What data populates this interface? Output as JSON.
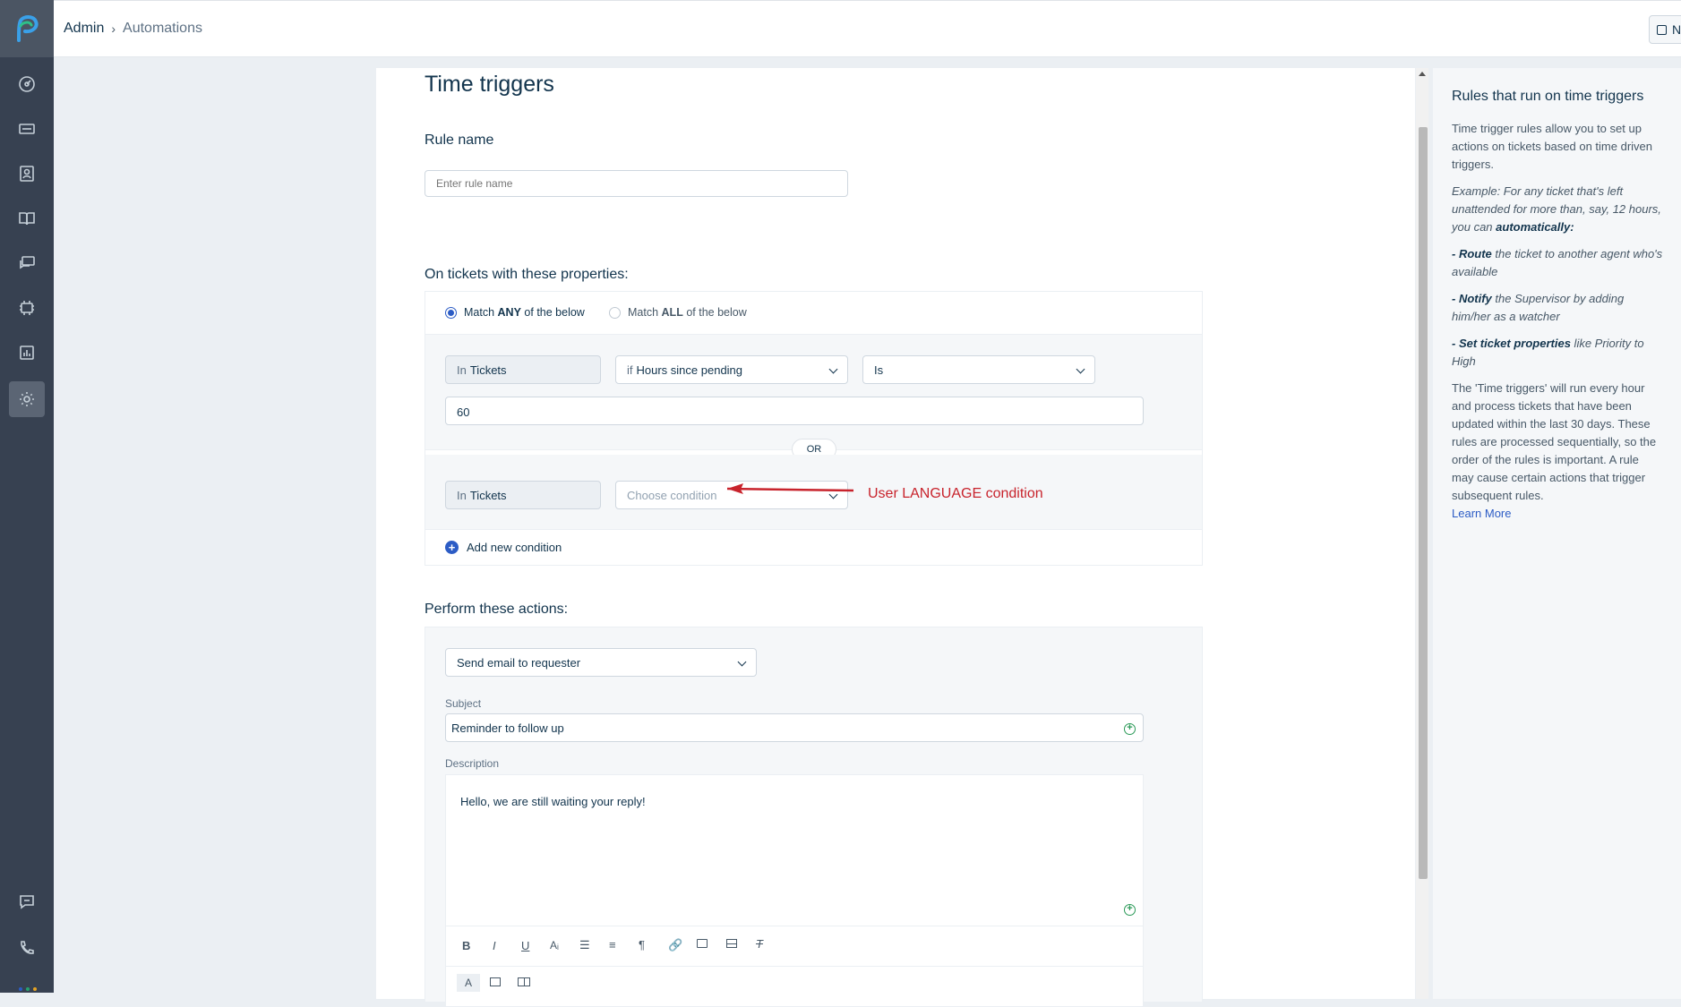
{
  "breadcrumb": {
    "admin": "Admin",
    "current": "Automations"
  },
  "header": {
    "new_button": "Ne"
  },
  "sidebar": {
    "items": [
      {
        "icon": "dashboard-icon"
      },
      {
        "icon": "tickets-icon"
      },
      {
        "icon": "contacts-icon"
      },
      {
        "icon": "solutions-icon"
      },
      {
        "icon": "forums-icon"
      },
      {
        "icon": "assets-icon"
      },
      {
        "icon": "reports-icon"
      },
      {
        "icon": "admin-gear-icon"
      }
    ],
    "bottom_items": [
      {
        "icon": "chat-icon"
      },
      {
        "icon": "phone-icon"
      }
    ],
    "dot_colors": [
      "#2c5cc5",
      "#27a16e",
      "#e5a323"
    ]
  },
  "form": {
    "title": "Time triggers",
    "rule_name_label": "Rule name",
    "rule_name_placeholder": "Enter rule name",
    "conditions_label": "On tickets with these properties:",
    "match_any": {
      "prefix": "Match",
      "bold": "ANY",
      "suffix": "of the below",
      "selected": true
    },
    "match_all": {
      "prefix": "Match",
      "bold": "ALL",
      "suffix": "of the below",
      "selected": false
    },
    "condition1": {
      "in_prefix": "In",
      "in_value": "Tickets",
      "field_prefix": "if",
      "field_value": "Hours since pending",
      "operator": "Is",
      "value": "60"
    },
    "or_label": "OR",
    "condition2": {
      "in_prefix": "In",
      "in_value": "Tickets",
      "field_placeholder": "Choose condition"
    },
    "annotation": "User LANGUAGE condition",
    "annotation_color": "#c8232c",
    "add_condition": "Add new condition",
    "actions_label": "Perform these actions:",
    "action_select": "Send email to requester",
    "subject_label": "Subject",
    "subject_value": "Reminder to follow up",
    "description_label": "Description",
    "description_value": "Hello, we are still waiting your reply!",
    "toolbar": [
      "B",
      "I",
      "U",
      "Aᵢ",
      "☰",
      "≡",
      "¶",
      "link-icon",
      "image-icon",
      "table-icon",
      "clear-format-icon"
    ]
  },
  "help": {
    "title": "Rules that run on time triggers",
    "intro": "Time trigger rules allow you to set up actions on tickets based on time driven triggers.",
    "example_prefix": "Example: For any ticket that's left unattended for more than, say, 12 hours, you can ",
    "example_bold": "automatically:",
    "route_bold": "- Route",
    "route_text": " the ticket to another agent who's available",
    "notify_bold": "- Notify",
    "notify_text": " the Supervisor by adding him/her as a watcher",
    "props_bold": "- Set ticket properties",
    "props_text": " like Priority to High",
    "body": "The 'Time triggers' will run every hour and process tickets that have been updated within the last 30 days. These rules are processed sequentially, so the order of the rules is important. A rule may cause certain actions that trigger subsequent rules.",
    "learn_more": "Learn More"
  }
}
